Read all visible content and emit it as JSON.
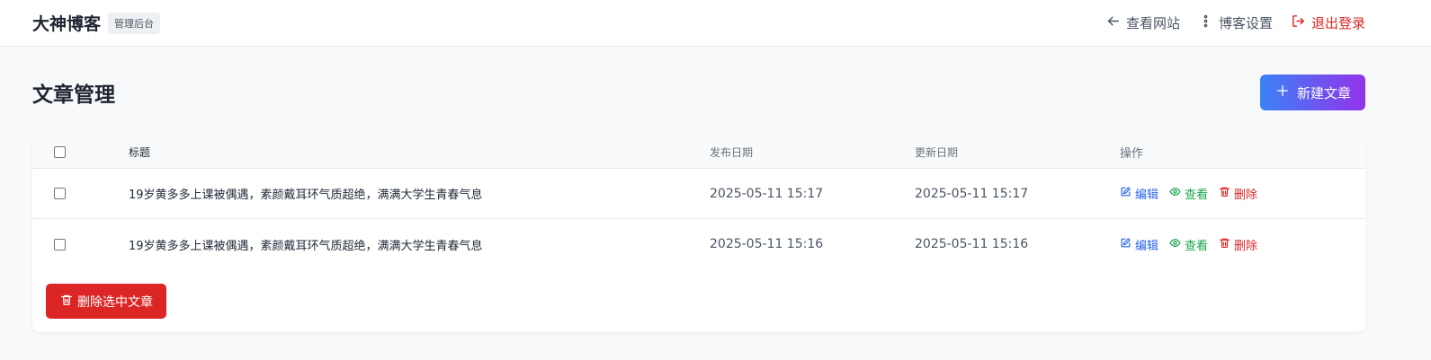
{
  "header": {
    "brand_title": "大神博客",
    "brand_badge": "管理后台",
    "nav": {
      "view_site": "查看网站",
      "blog_settings": "博客设置",
      "logout": "退出登录"
    }
  },
  "page": {
    "title": "文章管理",
    "new_article_label": "新建文章"
  },
  "table": {
    "columns": {
      "title": "标题",
      "published": "发布日期",
      "updated": "更新日期",
      "actions": "操作"
    },
    "rows": [
      {
        "checked": false,
        "title": "19岁黄多多上课被偶遇，素颜戴耳环气质超绝，满满大学生青春气息",
        "published": "2025-05-11 15:17",
        "updated": "2025-05-11 15:17"
      },
      {
        "checked": false,
        "title": "19岁黄多多上课被偶遇，素颜戴耳环气质超绝，满满大学生青春气息",
        "published": "2025-05-11 15:16",
        "updated": "2025-05-11 15:16"
      }
    ],
    "action_labels": {
      "edit": "编辑",
      "view": "查看",
      "delete": "删除"
    },
    "bulk_delete_label": "删除选中文章"
  },
  "colors": {
    "edit": "#2563eb",
    "view": "#16a34a",
    "danger": "#dc2626",
    "gradient_start": "#3b82f6",
    "gradient_end": "#9333ea"
  },
  "icons": {
    "view_site": "arrow-left-icon",
    "blog_settings": "settings-dots-icon",
    "logout": "logout-icon",
    "new_article": "plus-icon",
    "edit": "edit-icon",
    "view": "eye-icon",
    "delete": "trash-icon"
  }
}
